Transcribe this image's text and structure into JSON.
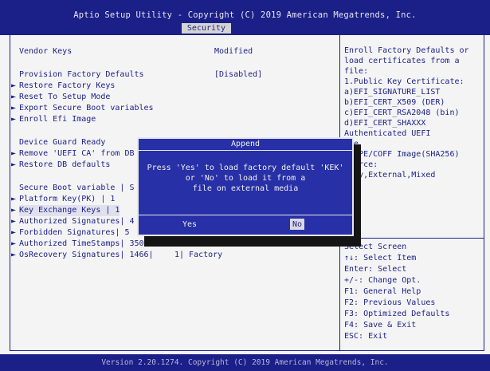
{
  "header": {
    "title": "Aptio Setup Utility - Copyright (C) 2019 American Megatrends, Inc.",
    "tab": "Security"
  },
  "left": {
    "column_header_left": "Vendor Keys",
    "column_header_right": "Modified",
    "items": [
      {
        "label": "Provision Factory Defaults",
        "value": "[Disabled]",
        "arrow": false
      },
      {
        "label": "Restore Factory Keys",
        "value": "",
        "arrow": true
      },
      {
        "label": "Reset To Setup Mode",
        "value": "",
        "arrow": true
      },
      {
        "label": "Export Secure Boot variables",
        "value": "",
        "arrow": true
      },
      {
        "label": "Enroll Efi Image",
        "value": "",
        "arrow": true
      },
      {
        "label": "Device Guard Ready",
        "value": "",
        "arrow": false
      },
      {
        "label": "Remove 'UEFI CA' from DB",
        "value": "",
        "arrow": true
      },
      {
        "label": "Restore DB defaults",
        "value": "",
        "arrow": true
      },
      {
        "label": "Secure Boot variable | S",
        "value": "",
        "arrow": false
      },
      {
        "label": "Platform Key(PK)      | 1",
        "value": "",
        "arrow": true
      },
      {
        "label": "Key Exchange Keys     | 1",
        "value": "",
        "arrow": true
      },
      {
        "label": "Authorized Signatures| 4",
        "value": "",
        "arrow": true
      },
      {
        "label": "Forbidden  Signatures| 5",
        "value": "",
        "arrow": true
      },
      {
        "label": "Authorized TimeStamps| 350",
        "value": "",
        "arrow": true
      },
      {
        "label": "OsRecovery Signatures| 1466|",
        "value": "1| Factory",
        "arrow": true
      }
    ]
  },
  "help": {
    "lines": [
      "Enroll Factory Defaults or",
      "load certificates from a",
      "file:",
      " 1.Public Key Certificate:",
      "  a)EFI_SIGNATURE_LIST",
      "  b)EFI_CERT_X509 (DER)",
      "  c)EFI_CERT_RSA2048 (bin)",
      "  d)EFI_CERT_SHAXXX",
      " Authenticated UEFI",
      "ble",
      "FI PE/COFF Image(SHA256)",
      "Source:",
      "tory,External,Mixed"
    ],
    "keys": [
      "Select Screen",
      "↑↓: Select Item",
      "Enter: Select",
      "+/-: Change Opt.",
      "F1: General Help",
      "F2: Previous Values",
      "F3: Optimized Defaults",
      "F4: Save & Exit",
      "ESC: Exit"
    ]
  },
  "dialog": {
    "title": "Append",
    "message_lines": [
      "Press 'Yes' to load factory default 'KEK'",
      "or 'No' to load it from a",
      "file on external media"
    ],
    "yes_label": "Yes",
    "no_label": "No"
  },
  "footer": {
    "text": "Version 2.20.1274. Copyright (C) 2019 American Megatrends, Inc."
  },
  "colors": {
    "bios_blue": "#1b1f88",
    "dialog_blue": "#2730a6",
    "background": "#f4f4f4"
  }
}
